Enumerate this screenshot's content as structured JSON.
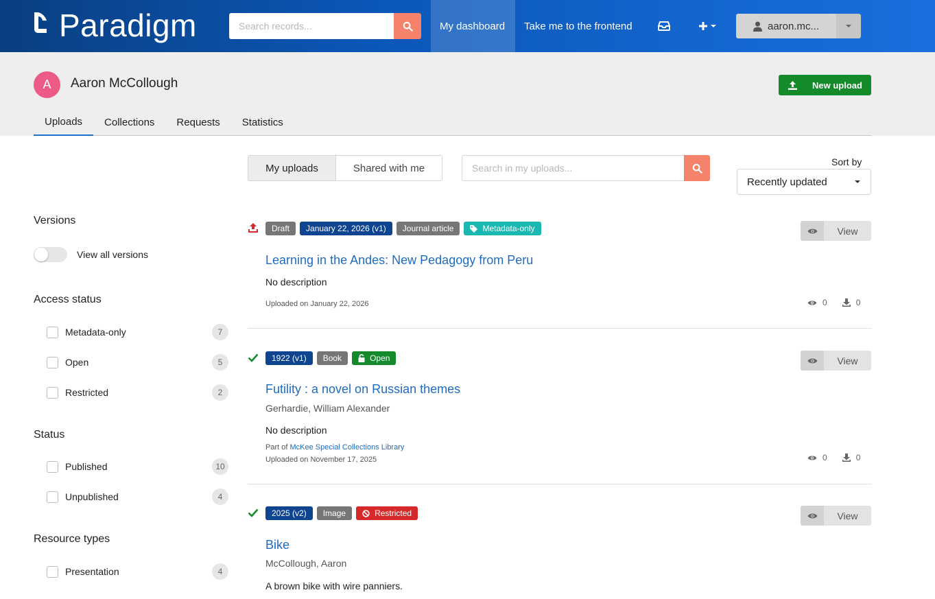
{
  "header": {
    "logo_text": "Paradigm",
    "search_placeholder": "Search records...",
    "nav": {
      "dashboard": "My dashboard",
      "frontend": "Take me to the frontend"
    },
    "user_label": "aaron.mc..."
  },
  "profile": {
    "avatar_letter": "A",
    "name": "Aaron McCollough",
    "new_upload_label": "New upload"
  },
  "tabs": [
    "Uploads",
    "Collections",
    "Requests",
    "Statistics"
  ],
  "toolbar": {
    "my_uploads": "My uploads",
    "shared_with_me": "Shared with me",
    "search_placeholder": "Search in my uploads...",
    "sort_label": "Sort by",
    "sort_value": "Recently updated"
  },
  "sidebar": {
    "versions": {
      "title": "Versions",
      "toggle_label": "View all versions"
    },
    "access_status": {
      "title": "Access status",
      "items": [
        {
          "label": "Metadata-only",
          "count": "7"
        },
        {
          "label": "Open",
          "count": "5"
        },
        {
          "label": "Restricted",
          "count": "2"
        }
      ]
    },
    "status": {
      "title": "Status",
      "items": [
        {
          "label": "Published",
          "count": "10"
        },
        {
          "label": "Unpublished",
          "count": "4"
        }
      ]
    },
    "resource_types": {
      "title": "Resource types",
      "items": [
        {
          "label": "Presentation",
          "count": "4"
        }
      ]
    }
  },
  "results": [
    {
      "badges": [
        "Draft",
        "January 22, 2026 (v1)",
        "Journal article",
        "Metadata-only"
      ],
      "title": "Learning in the Andes: New Pedagogy from Peru",
      "description": "No description",
      "uploaded": "Uploaded on January 22, 2026",
      "views": "0",
      "downloads": "0",
      "view_label": "View"
    },
    {
      "badges": [
        "1922 (v1)",
        "Book",
        "Open"
      ],
      "title": "Futility : a novel on Russian themes",
      "author": "Gerhardie, William Alexander",
      "description": "No description",
      "part_of_prefix": "Part of",
      "part_of": "McKee Special Collections Library",
      "uploaded": "Uploaded on November 17, 2025",
      "views": "0",
      "downloads": "0",
      "view_label": "View"
    },
    {
      "badges": [
        "2025 (v2)",
        "Image",
        "Restricted"
      ],
      "title": "Bike",
      "author": "McCollough, Aaron",
      "description": "A brown bike with wire panniers.",
      "view_label": "View"
    }
  ],
  "colors": {
    "header_gradient_start": "#0a3f80",
    "header_gradient_end": "#1a6fde",
    "accent_search": "#f5826b",
    "new_upload_green": "#148a2a",
    "link_blue": "#1f6bbf",
    "avatar_pink": "#ec5b86"
  },
  "icons": {
    "search": "search-icon",
    "inbox": "inbox-icon",
    "plus": "plus-icon",
    "user": "user-icon",
    "upload": "upload-icon",
    "eye": "eye-icon",
    "download": "download-icon",
    "check": "check-icon",
    "tag": "tag-icon",
    "unlock": "unlock-icon",
    "ban": "ban-icon"
  }
}
